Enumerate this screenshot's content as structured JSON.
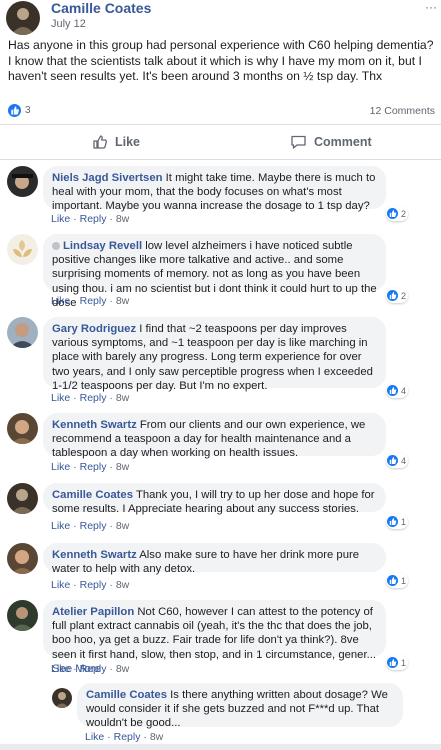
{
  "post": {
    "author": "Camille Coates",
    "time": "July 12",
    "menu": "···",
    "text": "Has anyone in this group had personal experience with C60 helping dementia? I know that the scientists talk about it which is why I have my mom on it, but I haven't seen results yet. It's been around 3 months on ½ tsp day. Thx",
    "reaction_count": "3",
    "comment_count": "12 Comments"
  },
  "actions": {
    "like_label": "Like",
    "comment_label": "Comment"
  },
  "comment_meta": {
    "like": "Like",
    "reply": "Reply",
    "sep": " · "
  },
  "comments": [
    {
      "author": "Niels Jagd Sivertsen",
      "text": "It might take time. Maybe there is much to heal with your mom, that the body focuses on what's most important. Maybe you wanna increase the dosage to 1 tsp day?",
      "age": "8w",
      "reactions": "2"
    },
    {
      "author": "Lindsay Revell",
      "text": "low level alzheimers i have noticed subtle positive changes like more talkative and active.. and some surprising moments of memory. not as long as you have been using thou. i am no scientist but i dont think it could hurt to up the dose",
      "age": "8w",
      "reactions": "2"
    },
    {
      "author": "Gary Rodriguez",
      "text": "I find that ~2 teaspoons per day improves various symptoms, and ~1 teaspoon per day is like marching in place with barely any progress. Long term experience for over two years, and I only saw perceptible progress when I exceeded 1-1/2 teaspoons per day. But I'm no expert.",
      "age": "8w",
      "reactions": "4"
    },
    {
      "author": "Kenneth Swartz",
      "text": "From our clients and our own experience, we recommend a teaspoon a day for health maintenance and a tablespoon a day when working on health issues.",
      "age": "8w",
      "reactions": "4"
    },
    {
      "author": "Camille Coates",
      "text": "Thank you, I will try to up her dose and hope for some results. I Appreciate hearing about any success stories.",
      "age": "8w",
      "reactions": "1"
    },
    {
      "author": "Kenneth Swartz",
      "text": "Also make sure to have her drink more pure water to help with any detox.",
      "age": "8w",
      "reactions": "1"
    },
    {
      "author": "Atelier Papillon",
      "text": "Not C60, however I can attest to the potency of full plant extract cannabis oil (yeah, it's the thc that does the job, boo hoo, ya get a buzz. Fair trade for life don't ya think?). 8ve seen it first hand, slow, then stop, and in 1 circumstance, gener...",
      "see_more": "See More",
      "age": "8w",
      "reactions": "1"
    }
  ],
  "reply": {
    "author": "Camille Coates",
    "text": "Is there anything written about dosage? We would consider it if she gets buzzed and not F***d up. That wouldn't be good...",
    "age": "8w"
  }
}
